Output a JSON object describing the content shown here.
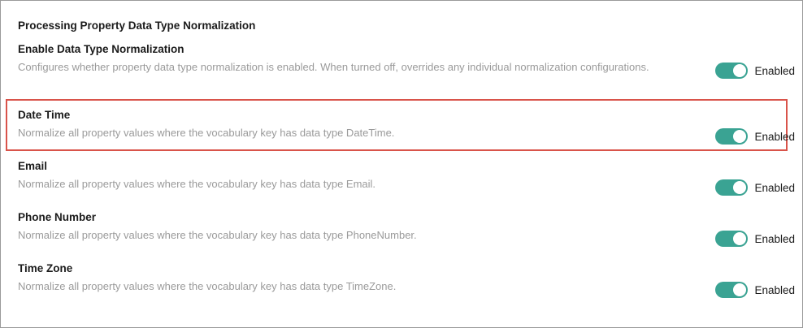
{
  "section": {
    "title": "Processing Property Data Type Normalization"
  },
  "settings": [
    {
      "title": "Enable Data Type Normalization",
      "description": "Configures whether property data type normalization is enabled. When turned off, overrides any individual normalization configurations.",
      "state": "Enabled",
      "on": true
    },
    {
      "title": "Date Time",
      "description": "Normalize all property values where the vocabulary key has data type DateTime.",
      "state": "Enabled",
      "on": true
    },
    {
      "title": "Email",
      "description": "Normalize all property values where the vocabulary key has data type Email.",
      "state": "Enabled",
      "on": true
    },
    {
      "title": "Phone Number",
      "description": "Normalize all property values where the vocabulary key has data type PhoneNumber.",
      "state": "Enabled",
      "on": true
    },
    {
      "title": "Time Zone",
      "description": "Normalize all property values where the vocabulary key has data type TimeZone.",
      "state": "Enabled",
      "on": true
    }
  ],
  "colors": {
    "toggle_on": "#3aa393",
    "highlight": "#d9534a"
  }
}
